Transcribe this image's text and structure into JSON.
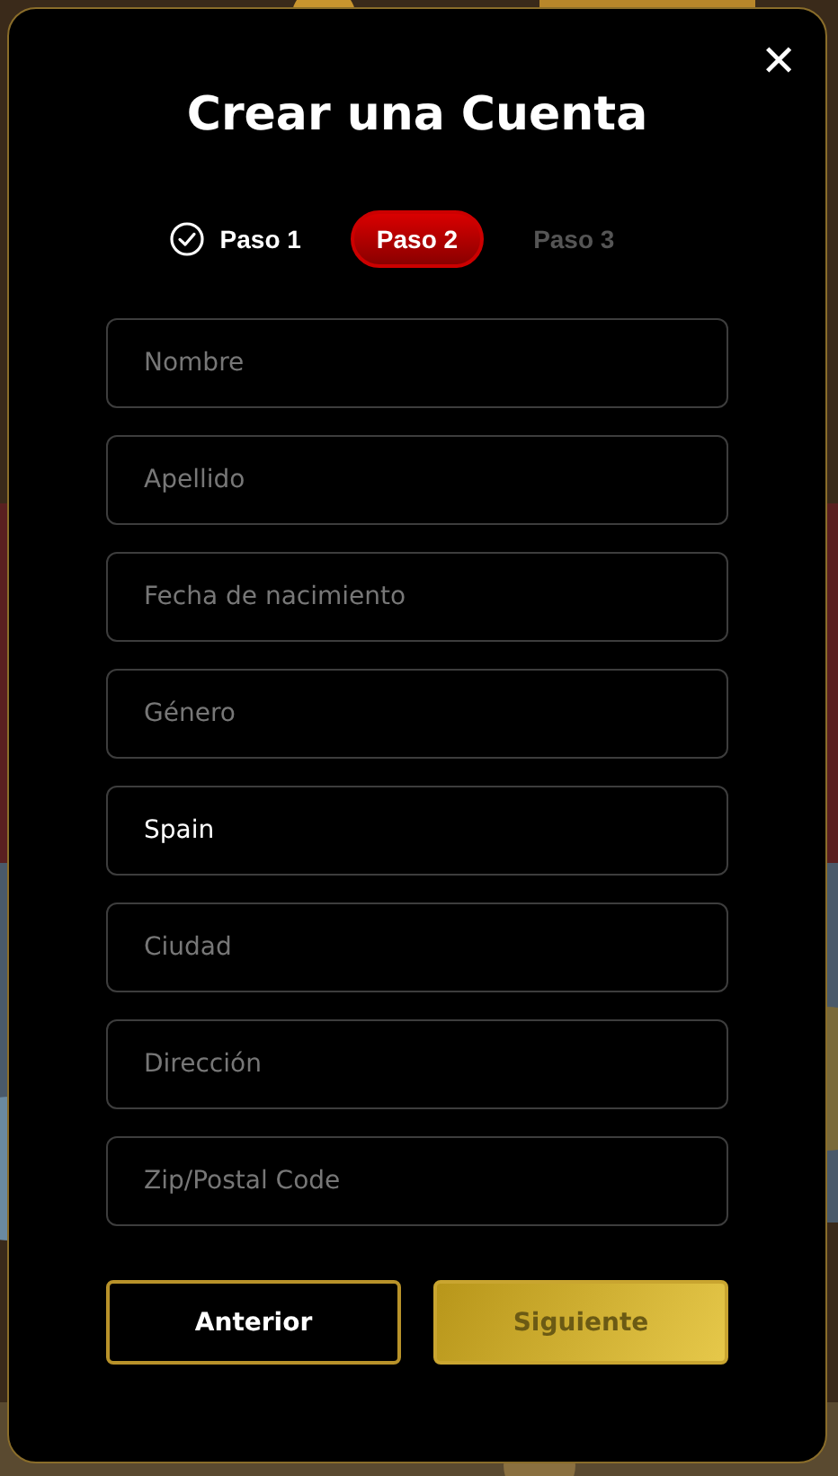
{
  "dialog": {
    "title": "Crear una Cuenta",
    "close": "✕"
  },
  "steps": [
    {
      "label": "Paso 1",
      "selected": false,
      "completed": true
    },
    {
      "label": "Paso 2",
      "selected": true,
      "completed": false
    },
    {
      "label": "Paso 3",
      "selected": false,
      "completed": false
    }
  ],
  "fields": [
    {
      "placeholder": "Nombre"
    },
    {
      "placeholder": "Apellido"
    },
    {
      "placeholder": "Fecha de nacimiento"
    },
    {
      "placeholder": "Género"
    },
    {
      "value": "Spain"
    },
    {
      "placeholder": "Ciudad"
    },
    {
      "placeholder": "Dirección"
    },
    {
      "placeholder": "Zip/Postal Code"
    }
  ],
  "buttons": [
    {
      "label": "Anterior",
      "kind": "outline",
      "disabled": false
    },
    {
      "label": "Siguiente",
      "kind": "primary",
      "disabled": true
    }
  ]
}
